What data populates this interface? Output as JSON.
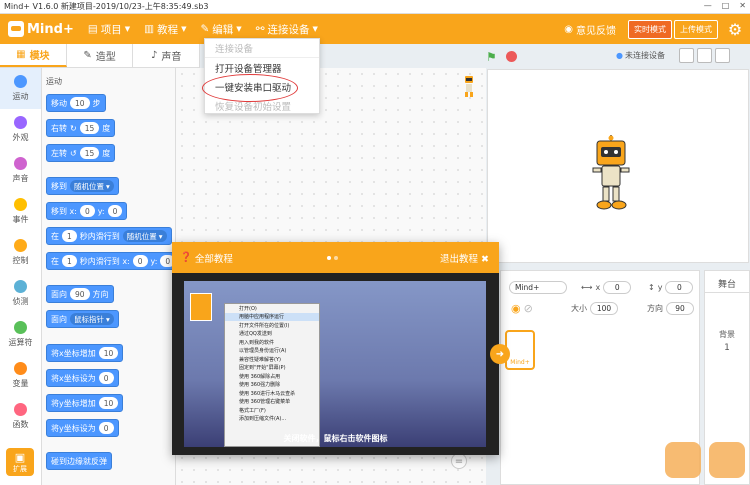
{
  "window": {
    "title": "Mind+ V1.6.0   新建项目-2019/10/23-上午8:35:49.sb3",
    "controls": [
      "—",
      "□",
      "✕"
    ]
  },
  "menubar": {
    "logo": "Mind+",
    "items": [
      {
        "label": "项目",
        "icon": "file-icon"
      },
      {
        "label": "教程",
        "icon": "book-icon"
      },
      {
        "label": "编辑",
        "icon": "edit-icon"
      },
      {
        "label": "连接设备",
        "icon": "link-icon"
      }
    ],
    "feedback": "意见反馈",
    "realtime_mode": "实时模式",
    "upload_mode": "上传模式"
  },
  "tabs": [
    {
      "label": "模块"
    },
    {
      "label": "造型"
    },
    {
      "label": "声音"
    }
  ],
  "categories": [
    {
      "label": "运动",
      "color": "#4c97ff"
    },
    {
      "label": "外观",
      "color": "#9966ff"
    },
    {
      "label": "声音",
      "color": "#cf63cf"
    },
    {
      "label": "事件",
      "color": "#ffbf00"
    },
    {
      "label": "控制",
      "color": "#ffab19"
    },
    {
      "label": "侦测",
      "color": "#5cb1d6"
    },
    {
      "label": "运算符",
      "color": "#59c059"
    },
    {
      "label": "变量",
      "color": "#ff8c1a"
    },
    {
      "label": "函数",
      "color": "#ff6680"
    }
  ],
  "extension": "扩展",
  "palette": {
    "title": "运动",
    "move": {
      "prefix": "移动",
      "value": "10",
      "suffix": "步"
    },
    "turn_right": {
      "prefix": "右转",
      "value": "15",
      "suffix": "度"
    },
    "turn_left": {
      "prefix": "左转",
      "value": "15",
      "suffix": "度"
    },
    "goto": {
      "prefix": "移到",
      "option": "随机位置"
    },
    "goto_xy": {
      "prefix": "移到 x:",
      "x": "0",
      "ylabel": "y:",
      "y": "0"
    },
    "glide": {
      "prefix": "在",
      "value": "1",
      "mid": "秒内滑行到",
      "option": "随机位置"
    },
    "glide_xy": {
      "prefix": "在",
      "value": "1",
      "mid": "秒内滑行到 x:",
      "x": "0",
      "ylabel": "y:",
      "y": "0"
    },
    "point_dir": {
      "prefix": "面向",
      "value": "90",
      "suffix": "方向"
    },
    "point_towards": {
      "prefix": "面向",
      "option": "鼠标指针"
    },
    "change_x": {
      "prefix": "将x坐标增加",
      "value": "10"
    },
    "set_x": {
      "prefix": "将x坐标设为",
      "value": "0"
    },
    "change_y": {
      "prefix": "将y坐标增加",
      "value": "10"
    },
    "set_y": {
      "prefix": "将y坐标设为",
      "value": "0"
    },
    "bounce": {
      "label": "碰到边缘就反弹"
    }
  },
  "connect_menu": {
    "items": [
      {
        "label": "连接设备",
        "disabled": true
      },
      {
        "label": "打开设备管理器",
        "disabled": false
      },
      {
        "label": "一键安装串口驱动",
        "disabled": false
      },
      {
        "label": "恢复设备初始设置",
        "disabled": true
      }
    ]
  },
  "stage_bar": {
    "device_status": "未连接设备"
  },
  "sprite": {
    "name": "Mind+",
    "x_label": "x",
    "x": "0",
    "y_label": "y",
    "y": "0",
    "size_label": "大小",
    "size": "100",
    "dir_label": "方向",
    "direction": "90",
    "thumb_label": "Mind+"
  },
  "stage_panel": {
    "title": "舞台",
    "backdrop_label": "背景",
    "backdrop_count": "1"
  },
  "tutorial": {
    "title": "全部教程",
    "exit": "退出教程",
    "caption": "关闭软件，鼠标右击软件图标",
    "context_menu": [
      "打开(O)",
      "用脑中应用程序运行",
      "打开文件所在的位置(I)",
      "通过QQ发送到",
      "",
      "用入到我的软件",
      "以管理员身份运行(A)",
      "兼容性疑难解答(Y)",
      "固定到\"开始\"屏幕(P)",
      "",
      "使用 360解除占用",
      "使用 360强力删除",
      "使用 360进行木马云查杀",
      "使用 360管理右键菜单",
      "",
      "格式工厂(F)",
      "添加到压缩文件(A)..."
    ]
  }
}
